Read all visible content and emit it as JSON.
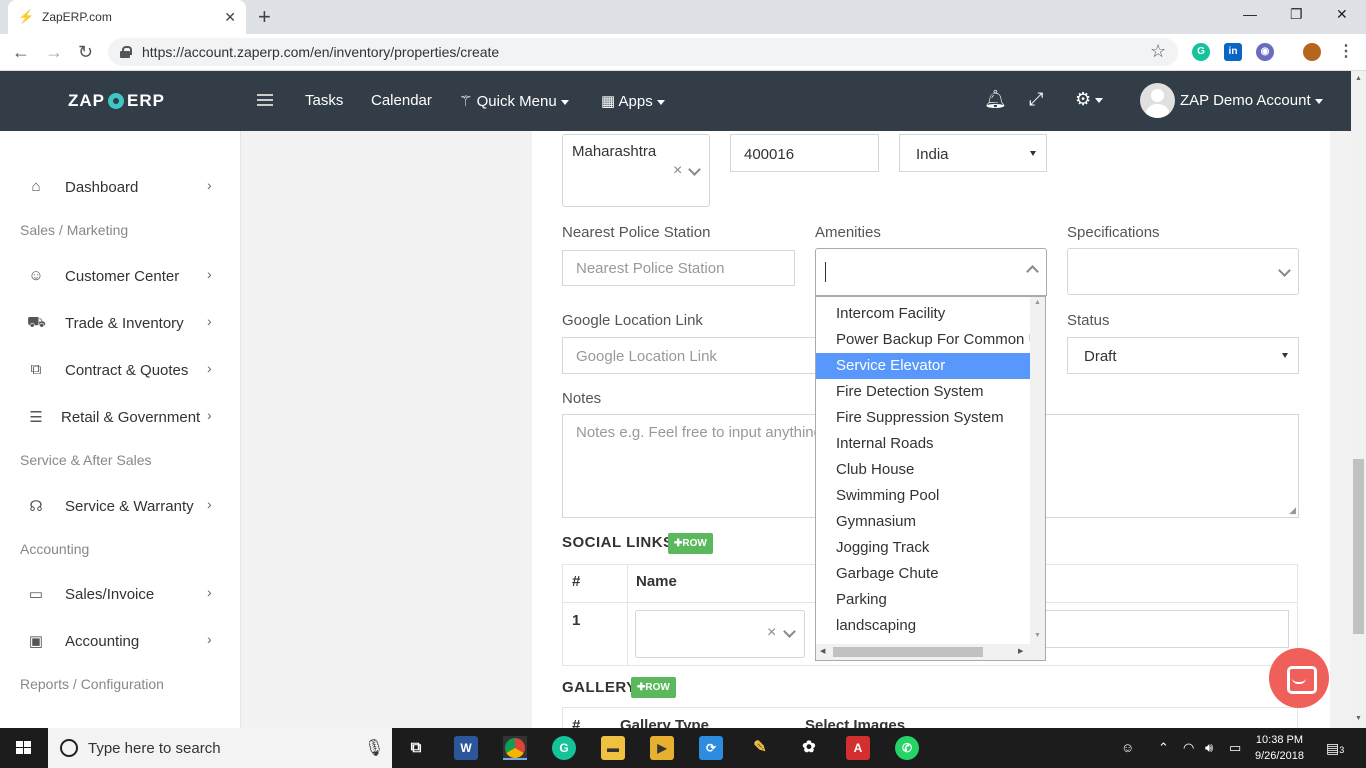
{
  "browser": {
    "tab_title": "ZapERP.com",
    "url": "https://account.zaperp.com/en/inventory/properties/create"
  },
  "header": {
    "logo_left": "ZAP",
    "logo_right": "ERP",
    "nav": {
      "tasks": "Tasks",
      "calendar": "Calendar",
      "quick_menu": "Quick Menu",
      "apps": "Apps"
    },
    "account": "ZAP Demo Account"
  },
  "sidebar": {
    "items": [
      {
        "label": "Dashboard",
        "icon": "home-icon"
      },
      {
        "label": "Customer Center",
        "icon": "user-icon"
      },
      {
        "label": "Trade & Inventory",
        "icon": "truck-icon"
      },
      {
        "label": "Contract & Quotes",
        "icon": "copy-icon"
      },
      {
        "label": "Retail & Government",
        "icon": "ledger-icon"
      },
      {
        "label": "Service & Warranty",
        "icon": "headset-icon"
      },
      {
        "label": "Sales/Invoice",
        "icon": "invoice-icon"
      },
      {
        "label": "Accounting",
        "icon": "wallet-icon"
      }
    ],
    "sections": {
      "sales": "Sales / Marketing",
      "service": "Service & After Sales",
      "accounting": "Accounting",
      "reports": "Reports / Configuration"
    }
  },
  "form": {
    "state_value": "Maharashtra",
    "pincode_value": "400016",
    "country_value": "India",
    "police_label": "Nearest Police Station",
    "police_placeholder": "Nearest Police Station",
    "amenities_label": "Amenities",
    "specifications_label": "Specifications",
    "google_label": "Google Location Link",
    "google_placeholder": "Google Location Link",
    "status_label": "Status",
    "status_value": "Draft",
    "notes_label": "Notes",
    "notes_placeholder": "Notes e.g. Feel free to input anything"
  },
  "social": {
    "title": "SOCIAL LINKS",
    "row_btn": "ROW",
    "col_hash": "#",
    "col_name": "Name",
    "row_num": "1"
  },
  "gallery": {
    "title": "GALLERY",
    "row_btn": "ROW",
    "col_hash": "#",
    "col_type": "Gallery Type",
    "col_images": "Select Images"
  },
  "amenities_options": [
    "Intercom Facility",
    "Power Backup For Common U",
    "Service Elevator",
    "Fire Detection System",
    "Fire Suppression System",
    "Internal Roads",
    "Club House",
    "Swimming Pool",
    "Gymnasium",
    "Jogging Track",
    "Garbage Chute",
    "Parking",
    "landscaping"
  ],
  "amenities_highlighted": "Service Elevator",
  "taskbar": {
    "search_placeholder": "Type here to search",
    "time": "10:38 PM",
    "date": "9/26/2018",
    "notifications": "3"
  },
  "colors": {
    "header_bg": "#333d47",
    "highlight": "#5897fb",
    "row_button": "#5cb85c",
    "chat": "#f0605b"
  }
}
